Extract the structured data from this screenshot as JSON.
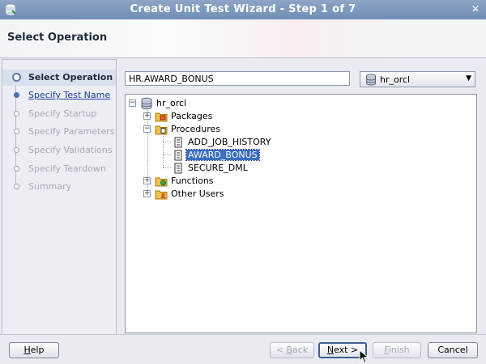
{
  "window": {
    "title": "Create Unit Test Wizard - Step 1 of 7",
    "close_glyph": "✕"
  },
  "header": {
    "title": "Select Operation"
  },
  "steps": [
    {
      "label": "Select Operation",
      "state": "active"
    },
    {
      "label": "Specify Test Name",
      "state": "link"
    },
    {
      "label": "Specify Startup",
      "state": "disabled"
    },
    {
      "label": "Specify Parameters",
      "state": "disabled"
    },
    {
      "label": "Specify Validations",
      "state": "disabled"
    },
    {
      "label": "Specify Teardown",
      "state": "disabled"
    },
    {
      "label": "Summary",
      "state": "disabled"
    }
  ],
  "operation_field": {
    "value": "HR.AWARD_BONUS"
  },
  "connection": {
    "value": "hr_orcl",
    "caret": "▼"
  },
  "tree": {
    "root": {
      "label": "hr_orcl",
      "toggle": "−"
    },
    "packages": {
      "label": "Packages",
      "toggle": "+"
    },
    "procedures": {
      "label": "Procedures",
      "toggle": "−",
      "children": [
        "ADD_JOB_HISTORY",
        "AWARD_BONUS",
        "SECURE_DML"
      ]
    },
    "functions": {
      "label": "Functions",
      "toggle": "+"
    },
    "other_users": {
      "label": "Other Users",
      "toggle": "+"
    }
  },
  "buttons": {
    "help": {
      "label": "Help",
      "mnemonic": "H",
      "rest": "elp"
    },
    "back": {
      "label": "< Back",
      "pre": "< ",
      "mnemonic": "B",
      "rest": "ack"
    },
    "next": {
      "label": "Next >",
      "mnemonic": "N",
      "rest": "ext >"
    },
    "finish": {
      "label": "Finish",
      "mnemonic": "F",
      "rest": "inish"
    },
    "cancel": {
      "label": "Cancel"
    }
  },
  "colors": {
    "title_bar": "#7f99bd",
    "selection": "#3a6cc0",
    "link": "#1e3f9a"
  }
}
